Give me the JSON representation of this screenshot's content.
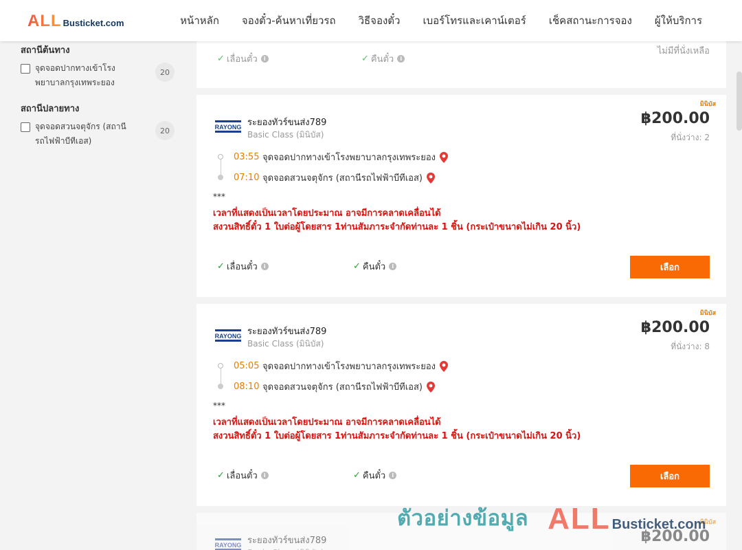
{
  "header": {
    "logo_all": "ALL",
    "logo_rest": "Busticket.com",
    "nav": [
      "หน้าหลัก",
      "จองตั๋ว-ค้นหาเที่ยวรถ",
      "วิธีจองตั๋ว",
      "เบอร์โทรและเคาน์เตอร์",
      "เช็คสถานะการจอง",
      "ผู้ให้บริการ"
    ]
  },
  "sidebar": {
    "origin": {
      "title": "สถานีต้นทาง",
      "items": [
        {
          "label": "จุดจอดปากทางเข้าโรงพยาบาลกรุงเทพระยอง",
          "count": "20"
        }
      ]
    },
    "destination": {
      "title": "สถานีปลายทาง",
      "items": [
        {
          "label": "จุดจอดสวนจตุจักร (สถานีรถไฟฟ้าบีทีเอส)",
          "count": "20"
        }
      ]
    }
  },
  "top_card": {
    "policy_reschedule": "เลื่อนตั๋ว",
    "policy_refund": "คืนตั๋ว",
    "status": "ไม่มีที่นั่งเหลือ"
  },
  "trips": [
    {
      "badge": "มินิบัส",
      "operator": "ระยองทัวร์ขนส่ง789",
      "class": "Basic Class (มินิบัส)",
      "price": "฿200.00",
      "seats": "ที่นั่งว่าง: 2",
      "depart_time": "03:55",
      "depart_stop": "จุดจอดปากทางเข้าโรงพยาบาลกรุงเทพระยอง",
      "arrive_time": "07:10",
      "arrive_stop": "จุดจอดสวนจตุจักร (สถานีรถไฟฟ้าบีทีเอส)",
      "note_stars": "***",
      "note_1": "เวลาที่แสดงเป็นเวลาโดยประมาณ อาจมีการคลาดเคลื่อนได้",
      "note_2": "สงวนสิทธิ์ตั๋ว 1 ใบต่อผู้โดยสาร 1ท่านสัมภาระจำกัดท่านละ 1 ชิ้น (กระเป๋าขนาดไม่เกิน 20 นิ้ว)",
      "policy_reschedule": "เลื่อนตั๋ว",
      "policy_refund": "คืนตั๋ว",
      "select_label": "เลือก"
    },
    {
      "badge": "มินิบัส",
      "operator": "ระยองทัวร์ขนส่ง789",
      "class": "Basic Class (มินิบัส)",
      "price": "฿200.00",
      "seats": "ที่นั่งว่าง: 8",
      "depart_time": "05:05",
      "depart_stop": "จุดจอดปากทางเข้าโรงพยาบาลกรุงเทพระยอง",
      "arrive_time": "08:10",
      "arrive_stop": "จุดจอดสวนจตุจักร (สถานีรถไฟฟ้าบีทีเอส)",
      "note_stars": "***",
      "note_1": "เวลาที่แสดงเป็นเวลาโดยประมาณ อาจมีการคลาดเคลื่อนได้",
      "note_2": "สงวนสิทธิ์ตั๋ว 1 ใบต่อผู้โดยสาร 1ท่านสัมภาระจำกัดท่านละ 1 ชิ้น (กระเป๋าขนาดไม่เกิน 20 นิ้ว)",
      "policy_reschedule": "เลื่อนตั๋ว",
      "policy_refund": "คืนตั๋ว",
      "select_label": "เลือก"
    },
    {
      "badge": "มินิบัส",
      "operator": "ระยองทัวร์ขนส่ง789",
      "class": "Basic Class (มินิบัส)",
      "price": "฿200.00"
    }
  ],
  "watermark": {
    "thai": "ตัวอย่างข้อมูล",
    "all": "ALL",
    "rest": "Busticket.com"
  },
  "colors": {
    "accent": "#f96a05",
    "time": "#e67e00",
    "warning": "#e01010",
    "check": "#2e9c3c"
  }
}
